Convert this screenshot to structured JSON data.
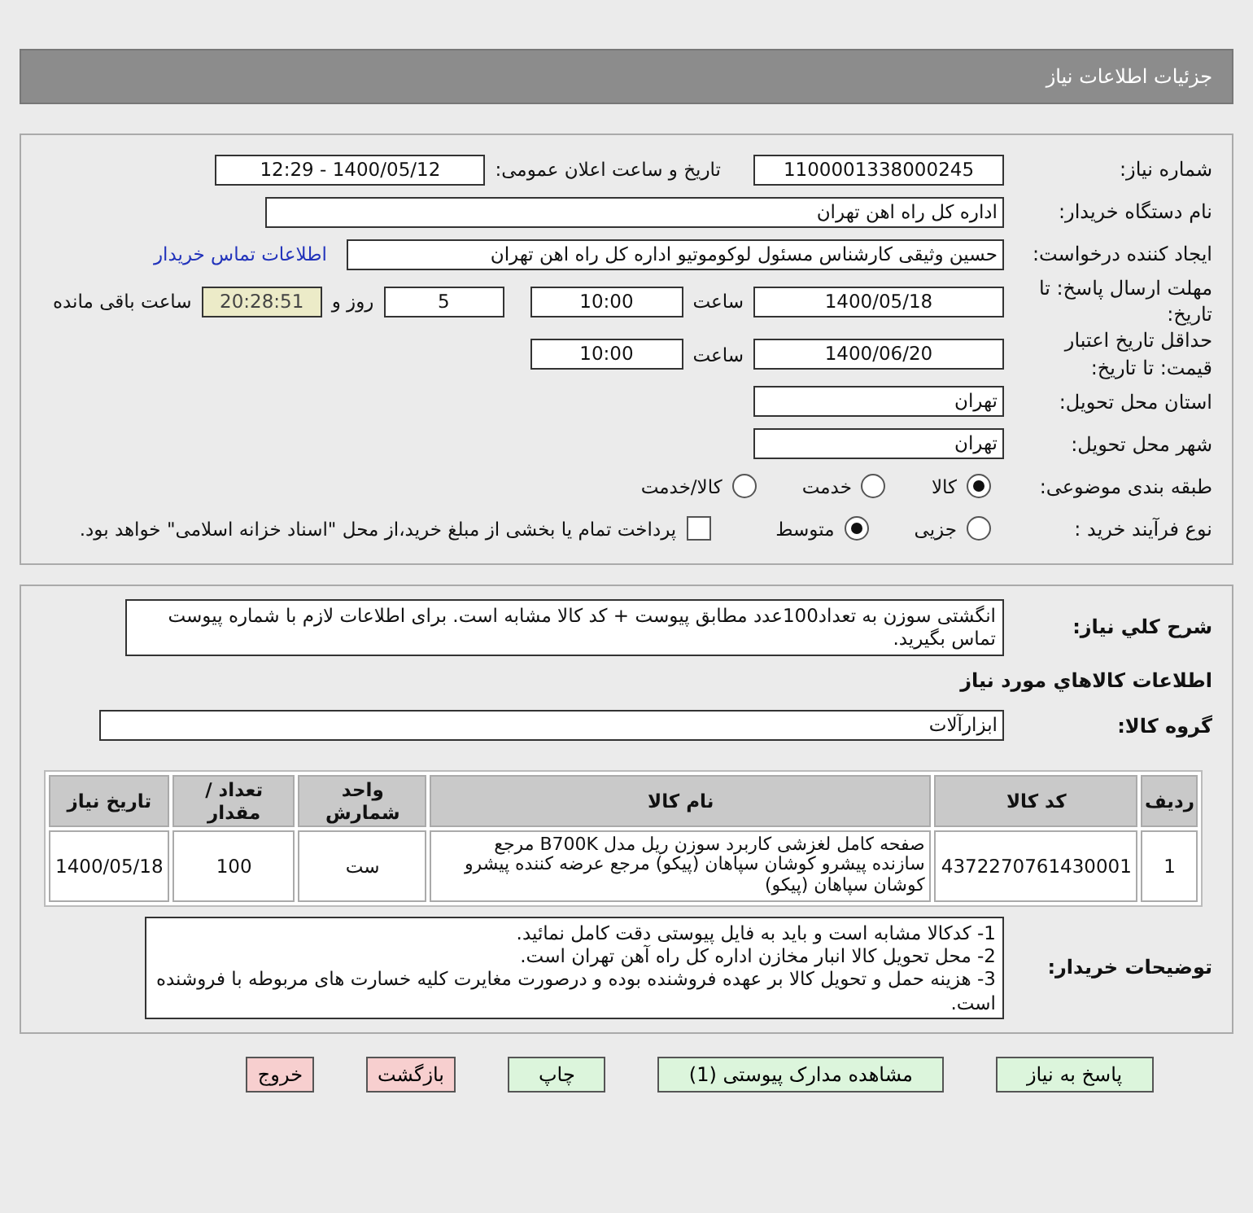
{
  "header": {
    "title": "جزئیات اطلاعات نیاز"
  },
  "details": {
    "need_number": {
      "label": "شماره نیاز:",
      "value": "1100001338000245"
    },
    "announce": {
      "label": "تاریخ و ساعت اعلان عمومی:",
      "value": "1400/05/12 - 12:29"
    },
    "buyer_org": {
      "label": "نام دستگاه خریدار:",
      "value": "اداره کل راه اهن تهران"
    },
    "requester": {
      "label": "ایجاد کننده درخواست:",
      "value": "حسین وثیقی کارشناس مسئول لوکوموتیو اداره کل راه اهن تهران",
      "link": "اطلاعات تماس خریدار"
    },
    "deadline": {
      "label": "مهلت ارسال پاسخ: تا تاریخ:",
      "date": "1400/05/18",
      "time_label": "ساعت",
      "time": "10:00",
      "days": "5",
      "days_label": "روز و",
      "remaining": "20:28:51",
      "remaining_label": "ساعت باقی مانده"
    },
    "validity": {
      "label": "حداقل تاریخ اعتبار قیمت: تا تاریخ:",
      "date": "1400/06/20",
      "time_label": "ساعت",
      "time": "10:00"
    },
    "province": {
      "label": "استان محل تحویل:",
      "value": "تهران"
    },
    "city": {
      "label": "شهر محل تحویل:",
      "value": "تهران"
    },
    "category": {
      "label": "طبقه بندی موضوعی:",
      "options": [
        {
          "label": "کالا",
          "selected": true
        },
        {
          "label": "خدمت",
          "selected": false
        },
        {
          "label": "کالا/خدمت",
          "selected": false
        }
      ]
    },
    "process": {
      "label": "نوع فرآیند خرید :",
      "options": [
        {
          "label": "جزیی",
          "selected": false
        },
        {
          "label": "متوسط",
          "selected": true
        }
      ],
      "payment": {
        "label": "پرداخت تمام یا بخشی از مبلغ خرید،از محل \"اسناد خزانه اسلامی\" خواهد بود.",
        "checked": false
      }
    }
  },
  "need": {
    "description_label": "شرح كلي نياز:",
    "description": "انگشتی سوزن به تعداد100عدد مطابق پیوست + کد کالا مشابه است. برای اطلاعات لازم با شماره پیوست تماس بگیرید.",
    "goods_heading": "اطلاعات كالاهاي مورد نياز",
    "group_label": "گروه کالا:",
    "group": "ابزارآلات",
    "table": {
      "columns": [
        "ردیف",
        "کد کالا",
        "نام کالا",
        "واحد شمارش",
        "تعداد / مقدار",
        "تاریخ نیاز"
      ],
      "rows": [
        [
          "1",
          "4372270761430001",
          "صفحه کامل لغزشی کاربرد سوزن ریل مدل B700K مرجع سازنده پیشرو کوشان سپاهان (پیکو) مرجع عرضه کننده پیشرو کوشان سپاهان (پیکو)",
          "ست",
          "100",
          "1400/05/18"
        ]
      ]
    },
    "notes_label": "توضیحات خریدار:",
    "notes": [
      "1- کدکالا مشابه است و باید به فایل پیوستی دقت کامل نمائید.",
      "2- محل تحویل کالا انبار مخازن اداره کل راه آهن تهران است.",
      "3- هزینه حمل و تحویل کالا بر عهده فروشنده بوده و درصورت مغایرت کلیه خسارت های مربوطه با فروشنده است."
    ]
  },
  "buttons": [
    {
      "label": "پاسخ به نیاز",
      "kind": "action"
    },
    {
      "label": "مشاهده مدارک پیوستی (1)",
      "kind": "action"
    },
    {
      "label": "چاپ",
      "kind": "action"
    },
    {
      "label": "بازگشت",
      "kind": "danger"
    },
    {
      "label": "خروج",
      "kind": "danger"
    }
  ]
}
